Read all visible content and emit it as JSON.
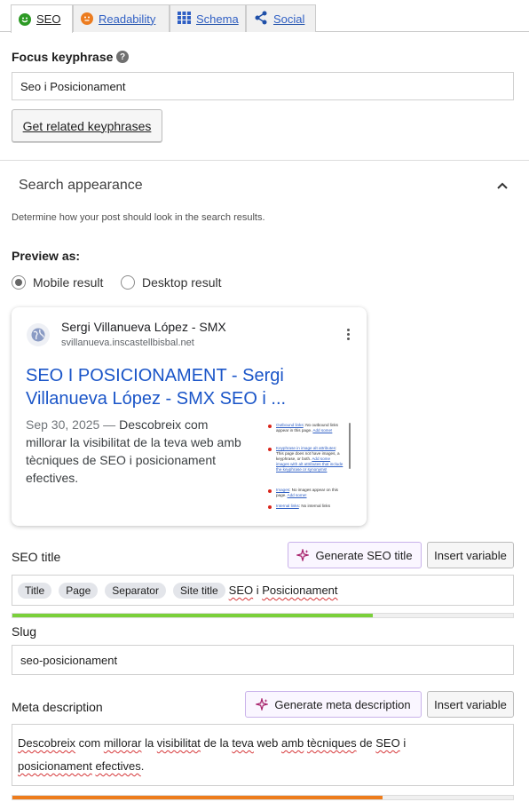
{
  "tabs": [
    {
      "label": "SEO",
      "icon": "smiley-good-icon",
      "color": "#2d9a25"
    },
    {
      "label": "Readability",
      "icon": "smiley-ok-icon",
      "color": "#ec7c1f"
    },
    {
      "label": "Schema",
      "icon": "grid-icon"
    },
    {
      "label": "Social",
      "icon": "share-icon"
    }
  ],
  "focus": {
    "label": "Focus keyphrase",
    "help": "?",
    "value": "Seo i Posicionament",
    "related_button": "Get related keyphrases"
  },
  "search_appearance": {
    "title": "Search appearance",
    "description": "Determine how your post should look in the search results.",
    "preview_label": "Preview as:",
    "mobile_option": "Mobile result",
    "desktop_option": "Desktop result",
    "selected": "mobile"
  },
  "preview": {
    "site_name": "Sergi Villanueva López - SMX",
    "site_url": "svillanueva.inscastellbisbal.net",
    "title": "SEO I POSICIONAMENT - Sergi Villanueva López - SMX SEO i ...",
    "date": "Sep 30, 2025",
    "date_sep": " — ",
    "description": "Descobreix com millorar la visibilitat de la teva web amb tècniques de SEO i posicionament efectives.",
    "thumbnail_lines": [
      {
        "link": "Outbound links",
        "text": ": No outbound links appear in this page. ",
        "action": "Add some!"
      },
      {
        "link": "Keyphrase in image alt attributes",
        "text": ": This page does not have images, a keyphrase, or both. ",
        "action": "Add some images with alt attributes that include the keyphrase or synonyms!"
      },
      {
        "link": "Images",
        "text": ": No images appear on this page. ",
        "action": "Add some!"
      },
      {
        "link": "Internal links",
        "text": ": No internal links",
        "action": ""
      }
    ]
  },
  "seo_title": {
    "label": "SEO title",
    "generate_button": "Generate SEO title",
    "insert_button": "Insert variable",
    "pills": [
      "Title",
      "Page",
      "Separator",
      "Site title"
    ],
    "text_before": "SEO",
    "text_middle": " i ",
    "text_after": "Posicionament",
    "progress": 0.72,
    "progress_color": "#7ad03a"
  },
  "slug": {
    "label": "Slug",
    "value": "seo-posicionament"
  },
  "meta": {
    "label": "Meta description",
    "generate_button": "Generate meta description",
    "insert_button": "Insert variable",
    "line1_a": "Descobreix",
    "line1_b": " com ",
    "line1_c": "millorar",
    "line1_d": " la ",
    "line1_e": "visibilitat",
    "line1_f": " de la ",
    "line1_g": "teva",
    "line1_h": " web ",
    "line1_i": "amb",
    "line1_j": " ",
    "line1_k": "tècniques",
    "line1_l": " de ",
    "line1_m": "SEO",
    "line1_n": " i",
    "line2_a": "posicionament",
    "line2_b": " ",
    "line2_c": "efectives",
    "line2_d": ".",
    "progress": 0.74,
    "progress_color": "#ee7c1b"
  }
}
